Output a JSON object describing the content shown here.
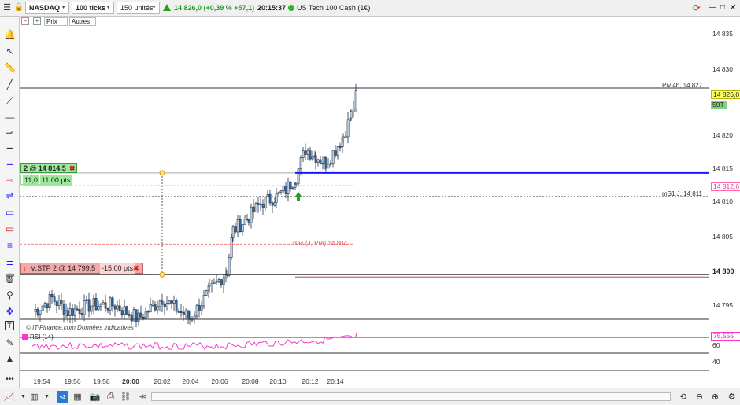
{
  "toolbar": {
    "instrument": "NASDAQ",
    "period": "100 ticks",
    "units": "150 unités",
    "price_change": "14 826,0 (+0,39 % +57,1)",
    "time": "20:15:37",
    "product_name": "US Tech 100 Cash (1€)"
  },
  "subtabs": {
    "prix": "Prix",
    "autres": "Autres"
  },
  "chart": {
    "pivot_label": "Piv 4h, 14 827",
    "ms1_label": "mS1 J, 14 811",
    "low_label": "Bas (J, Pré) 14 804",
    "watermark": "© IT-Finance.com Données indicatives",
    "rsi_label": "RSI (14)"
  },
  "orders": {
    "buy_label": "2 @ 14 814,5",
    "buy_pts_a": "11,0",
    "buy_pts_b": "11,00 pts",
    "stop_label": "V:STP 2 @ 14 799,5",
    "stop_pts": "-15,00 pts"
  },
  "price_axis": {
    "ticks": [
      "14 835",
      "14 830",
      "14 820",
      "14 815",
      "14 810",
      "14 805",
      "14 795"
    ],
    "tag_last": "14 826,0",
    "tag_count": "59T",
    "tag_level": "14 812,6",
    "bold_level": "14 800",
    "rsi_value": "75,555",
    "rsi_ticks": [
      "60",
      "40"
    ]
  },
  "time_axis": [
    "19:54",
    "19:56",
    "19:58",
    "20:00",
    "20:02",
    "20:04",
    "20:06",
    "20:08",
    "20:10",
    "20:12",
    "20:14"
  ],
  "colors": {
    "candle": "#3a6ea5",
    "blue_line": "#1a1aff",
    "rsi": "#ff33cc",
    "green": "#22a022",
    "stop_bg": "#f2a9a9"
  }
}
